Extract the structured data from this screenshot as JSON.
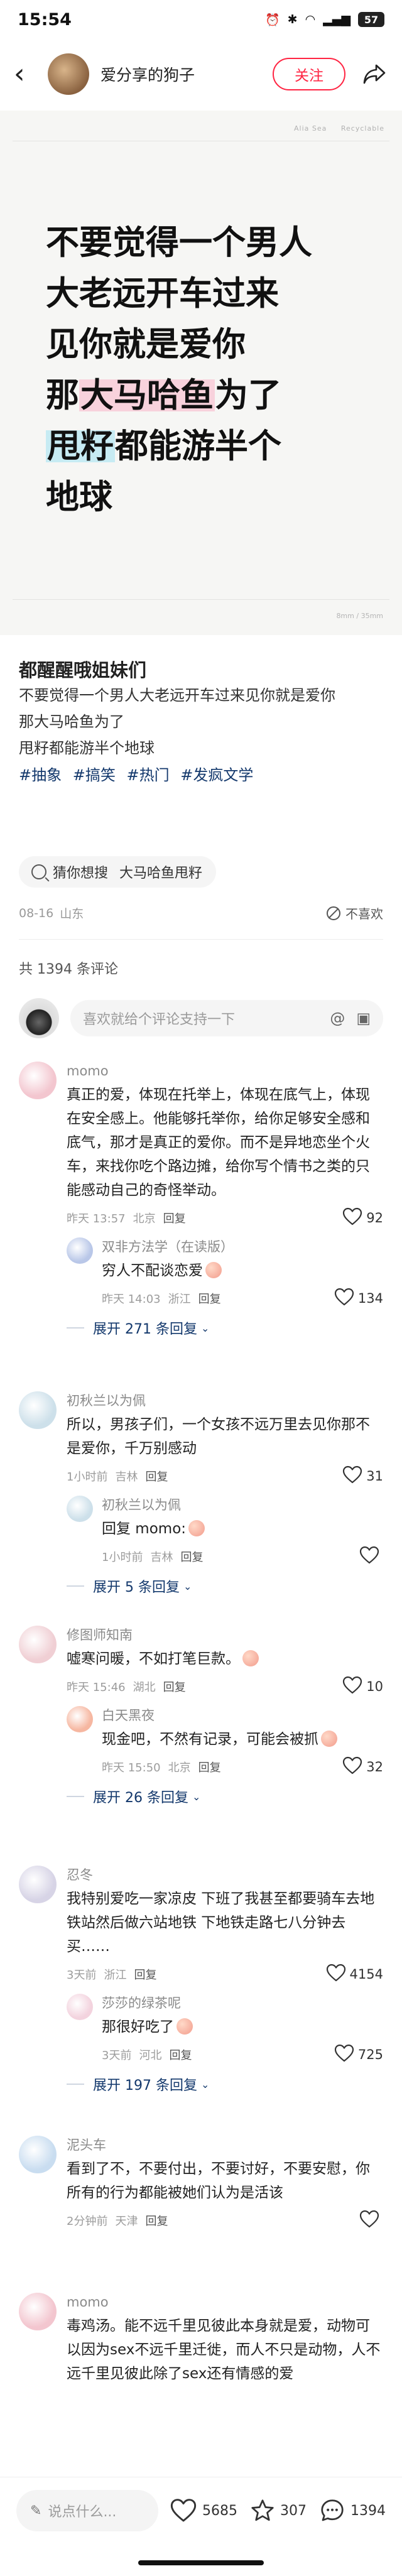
{
  "status_bar": {
    "time": "15:54",
    "battery": "57",
    "icons": [
      "alarm-icon",
      "bluetooth-icon",
      "wifi-icon",
      "signal-icon",
      "battery-icon"
    ]
  },
  "header": {
    "author_name": "爱分享的狗子",
    "follow_label": "关注"
  },
  "post_image": {
    "meta_left": "Alia Sea",
    "meta_right": "Recyclable",
    "footer": "8mm / 35mm",
    "lines": [
      [
        {
          "t": "不要觉得一个男人"
        }
      ],
      [
        {
          "t": "大老远开车过来"
        }
      ],
      [
        {
          "t": "见你就是爱你"
        }
      ],
      [
        {
          "t": "那"
        },
        {
          "t": "大马哈鱼",
          "hl": "pink"
        },
        {
          "t": "为了"
        }
      ],
      [
        {
          "t": "甩籽",
          "hl": "blue"
        },
        {
          "t": "都能游半个"
        }
      ],
      [
        {
          "t": "地球"
        }
      ]
    ]
  },
  "post": {
    "title": "都醒醒哦姐妹们",
    "lines": [
      "不要觉得一个男人大老远开车过来见你就是爱你",
      "那大马哈鱼为了",
      "甩籽都能游半个地球"
    ],
    "tags": [
      "#抽象",
      "#搞笑",
      "#热门",
      "#发疯文学"
    ],
    "guess_label": "猜你想搜",
    "guess_keyword": "大马哈鱼甩籽",
    "date": "08-16",
    "location": "山东",
    "dislike_label": "不喜欢"
  },
  "comments_section": {
    "count_label": "共 1394 条评论",
    "input_placeholder": "喜欢就给个评论支持一下"
  },
  "comments": [
    {
      "name": "momo",
      "text": "真正的爱，体现在托举上，体现在底气上，体现在安全感上。他能够托举你，给你足够安全感和底气，那才是真正的爱你。而不是异地恋坐个火车，来找你吃个路边摊，给你写个情书之类的只能感动自己的奇怪举动。",
      "time": "昨天 13:57",
      "loc": "北京",
      "reply": "回复",
      "likes": "92",
      "avatar": "#f3c6cf",
      "sub": {
        "name": "双非方法学（在读版）",
        "text": "穷人不配谈恋爱",
        "emoji": true,
        "time": "昨天 14:03",
        "loc": "浙江",
        "reply": "回复",
        "likes": "134",
        "avatar": "#b9c7e8"
      },
      "expand": "展开 271 条回复"
    },
    {
      "name": "初秋兰以为佩",
      "text": "所以，男孩子们，一个女孩不远万里去见你那不是爱你，千万别感动",
      "time": "1小时前",
      "loc": "吉林",
      "reply": "回复",
      "likes": "31",
      "avatar": "#cde0ea",
      "sub": {
        "name": "初秋兰以为佩",
        "text": "回复 momo:",
        "emoji": true,
        "time": "1小时前",
        "loc": "吉林",
        "reply": "回复",
        "likes": "",
        "avatar": "#cde0ea"
      },
      "expand": "展开 5 条回复"
    },
    {
      "name": "修图师知南",
      "text": "嘘寒问暖，不如打笔巨款。",
      "emoji": true,
      "time": "昨天 15:46",
      "loc": "湖北",
      "reply": "回复",
      "likes": "10",
      "avatar": "#f0cfd4",
      "sub": {
        "name": "白天黑夜",
        "text": "现金吧，不然有记录，可能会被抓",
        "emoji": true,
        "time": "昨天 15:50",
        "loc": "北京",
        "reply": "回复",
        "likes": "32",
        "avatar": "#f6b7a1"
      },
      "expand": "展开 26 条回复"
    },
    {
      "name": "忍冬",
      "text": "我特别爱吃一家凉皮 下班了我甚至都要骑车去地铁站然后做六站地铁 下地铁走路七八分钟去买……",
      "time": "3天前",
      "loc": "浙江",
      "reply": "回复",
      "likes": "4154",
      "avatar": "#d7d4e6",
      "sub": {
        "name": "莎莎的绿茶呢",
        "text": "那很好吃了",
        "emoji": true,
        "time": "3天前",
        "loc": "河北",
        "reply": "回复",
        "likes": "725",
        "avatar": "#f3d3de"
      },
      "expand": "展开 197 条回复"
    },
    {
      "name": "泥头车",
      "text": "看到了不，不要付出，不要讨好，不要安慰，你所有的行为都能被她们认为是活该",
      "time": "2分钟前",
      "loc": "天津",
      "reply": "回复",
      "likes": "",
      "avatar": "#c9ddf0"
    },
    {
      "name": "momo",
      "text": "毒鸡汤。能不远千里见彼此本身就是爱，动物可以因为sex不远千里迁徙，而人不只是动物，人不远千里见彼此除了sex还有情感的爱",
      "time": "",
      "loc": "",
      "reply": "",
      "likes": "",
      "avatar": "#f3c6cf"
    }
  ],
  "bottom_bar": {
    "input_placeholder": "说点什么...",
    "likes": "5685",
    "collects": "307",
    "comments": "1394"
  }
}
